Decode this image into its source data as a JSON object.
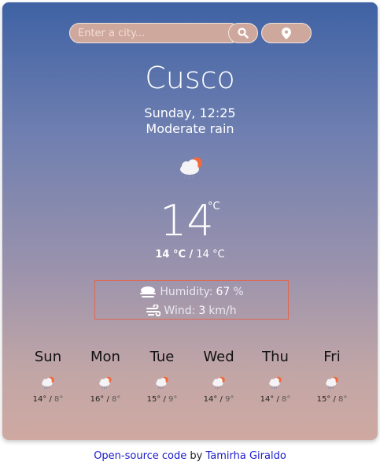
{
  "search": {
    "placeholder": "Enter a city..."
  },
  "city": "Cusco",
  "datetime": "Sunday, 12:25",
  "description": "Moderate rain",
  "temperature": {
    "value": "14",
    "unit": "°C"
  },
  "hilo": {
    "high": "14 °C /",
    "low": "14 °C"
  },
  "details": {
    "humidity_label": "Humidity:",
    "humidity_value": "67",
    "humidity_unit": "%",
    "wind_label": "Wind:",
    "wind_value": "3",
    "wind_unit": "km/h"
  },
  "forecast": [
    {
      "day": "Sun",
      "max": "14° /",
      "min": "8°"
    },
    {
      "day": "Mon",
      "max": "16° /",
      "min": "8°"
    },
    {
      "day": "Tue",
      "max": "15° /",
      "min": "9°"
    },
    {
      "day": "Wed",
      "max": "14° /",
      "min": "9°"
    },
    {
      "day": "Thu",
      "max": "14° /",
      "min": "8°"
    },
    {
      "day": "Fri",
      "max": "15° /",
      "min": "8°"
    }
  ],
  "footer": {
    "link_text": "Open-source code",
    "by": "by",
    "author": "Tamirha Giraldo"
  },
  "icons": {
    "search": "search-icon",
    "location": "location-pin-icon",
    "weather": "rain-cloud-sun-icon",
    "humidity": "mist-icon",
    "wind": "wind-icon"
  }
}
